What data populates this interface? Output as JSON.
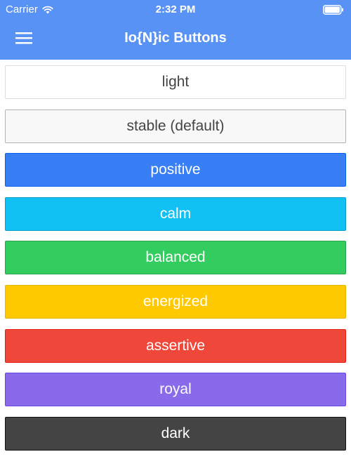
{
  "status_bar": {
    "carrier": "Carrier",
    "time": "2:32 PM"
  },
  "header": {
    "title": "Io{N}ic Buttons",
    "background": "#5992f5"
  },
  "buttons": [
    {
      "label": "light",
      "bg": "#ffffff",
      "fg": "#444444",
      "border": "#dddddd"
    },
    {
      "label": "stable (default)",
      "bg": "#f8f8f8",
      "fg": "#444444",
      "border": "#b2b2b2"
    },
    {
      "label": "positive",
      "bg": "#387ef5",
      "fg": "#ffffff",
      "border": "#0c60ee"
    },
    {
      "label": "calm",
      "bg": "#11c1f3",
      "fg": "#ffffff",
      "border": "#0a9dc7"
    },
    {
      "label": "balanced",
      "bg": "#33cd5f",
      "fg": "#ffffff",
      "border": "#28a54c"
    },
    {
      "label": "energized",
      "bg": "#ffc900",
      "fg": "#ffffff",
      "border": "#e6b500"
    },
    {
      "label": "assertive",
      "bg": "#ef473a",
      "fg": "#ffffff",
      "border": "#e42112"
    },
    {
      "label": "royal",
      "bg": "#886aea",
      "fg": "#ffffff",
      "border": "#6b46e5"
    },
    {
      "label": "dark",
      "bg": "#444444",
      "fg": "#ffffff",
      "border": "#111111"
    }
  ]
}
